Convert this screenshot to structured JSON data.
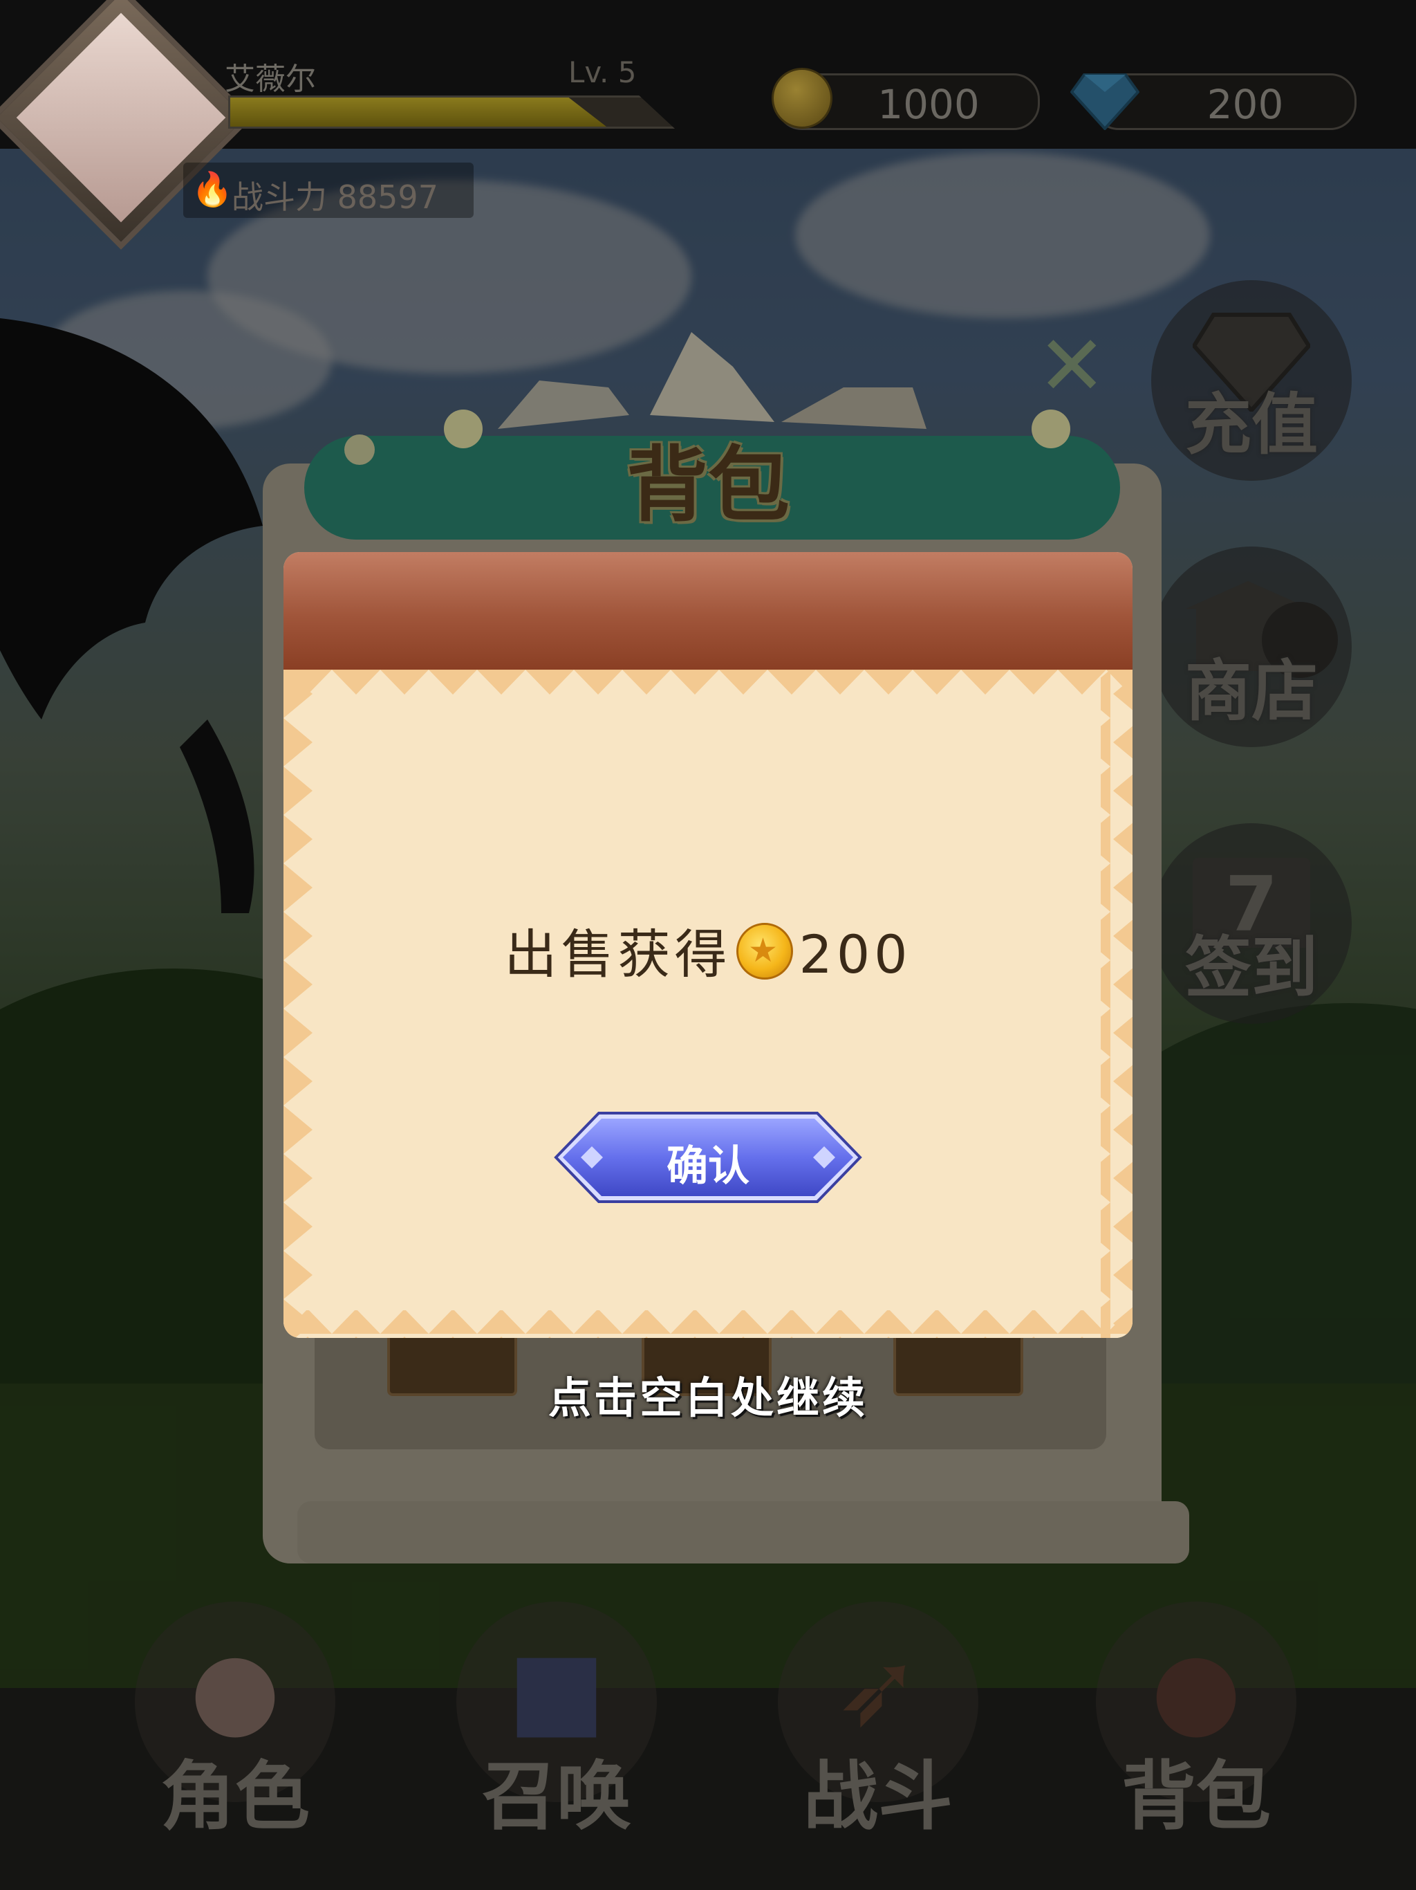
{
  "header": {
    "player_name": "艾薇尔",
    "level": "Lv. 5",
    "xp_fraction": 0.85,
    "power_label": "战斗力",
    "power_value": "88597",
    "gold": "1000",
    "diamonds": "200"
  },
  "side_menu": [
    {
      "label": "充值",
      "icon": "diamond-icon"
    },
    {
      "label": "商店",
      "icon": "shop-icon"
    },
    {
      "label": "签到",
      "icon": "calendar-icon",
      "badge": "7"
    }
  ],
  "bottom_nav": [
    {
      "label": "角色",
      "icon": "character-icon"
    },
    {
      "label": "召唤",
      "icon": "summon-book-icon"
    },
    {
      "label": "战斗",
      "icon": "bow-icon"
    },
    {
      "label": "背包",
      "icon": "bag-icon"
    }
  ],
  "panel": {
    "title": "背包",
    "close_icon": "close-icon"
  },
  "dialog": {
    "message_prefix": "出售获得",
    "amount": "200",
    "confirm_label": "确认",
    "hint": "点击空白处继续"
  },
  "colors": {
    "confirm_button": "#5a67e0",
    "dialog_body": "#f8e5c4",
    "dialog_header": "#a0553a",
    "banner": "#2a9a82"
  }
}
